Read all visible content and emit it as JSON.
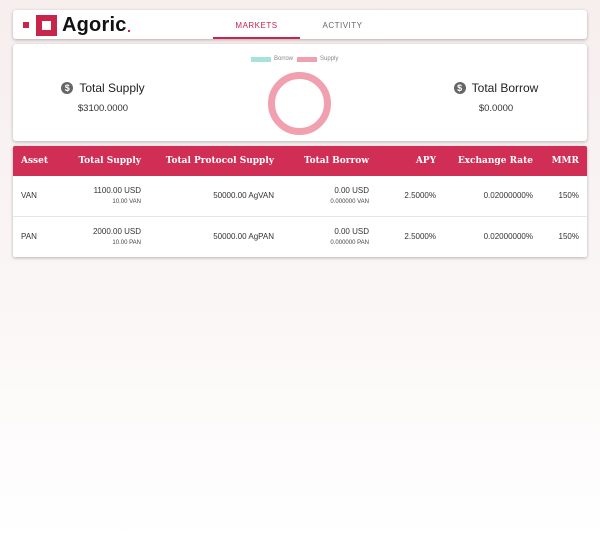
{
  "brand": {
    "name": "Agoric"
  },
  "nav": {
    "tabs": [
      {
        "label": "MARKETS",
        "active": true
      },
      {
        "label": "ACTIVITY",
        "active": false
      }
    ]
  },
  "summary": {
    "total_supply": {
      "label": "Total Supply",
      "value": "$3100.0000",
      "icon": "dollar-icon"
    },
    "total_borrow": {
      "label": "Total Borrow",
      "value": "$0.0000",
      "icon": "dollar-icon"
    },
    "legend": [
      {
        "label": "Borrow",
        "color": "#a6e4da"
      },
      {
        "label": "Supply",
        "color": "#f0a0ae"
      }
    ],
    "donut": {
      "borrow": 0,
      "supply": 3100
    }
  },
  "table": {
    "columns": [
      "Asset",
      "Total Supply",
      "Total Protocol Supply",
      "Total Borrow",
      "APY",
      "Exchange Rate",
      "MMR"
    ],
    "rows": [
      {
        "asset": "VAN",
        "total_supply": "1100.00 USD",
        "total_supply_sub": "10.00 VAN",
        "protocol_supply": "50000.00 AgVAN",
        "total_borrow": "0.00 USD",
        "total_borrow_sub": "0.000000 VAN",
        "apy": "2.5000%",
        "exchange_rate": "0.02000000%",
        "mmr": "150%"
      },
      {
        "asset": "PAN",
        "total_supply": "2000.00 USD",
        "total_supply_sub": "10.00 PAN",
        "protocol_supply": "50000.00 AgPAN",
        "total_borrow": "0.00 USD",
        "total_borrow_sub": "0.000000 PAN",
        "apy": "2.5000%",
        "exchange_rate": "0.02000000%",
        "mmr": "150%"
      }
    ]
  },
  "colors": {
    "accent": "#c9254c",
    "header": "#d02e55"
  }
}
